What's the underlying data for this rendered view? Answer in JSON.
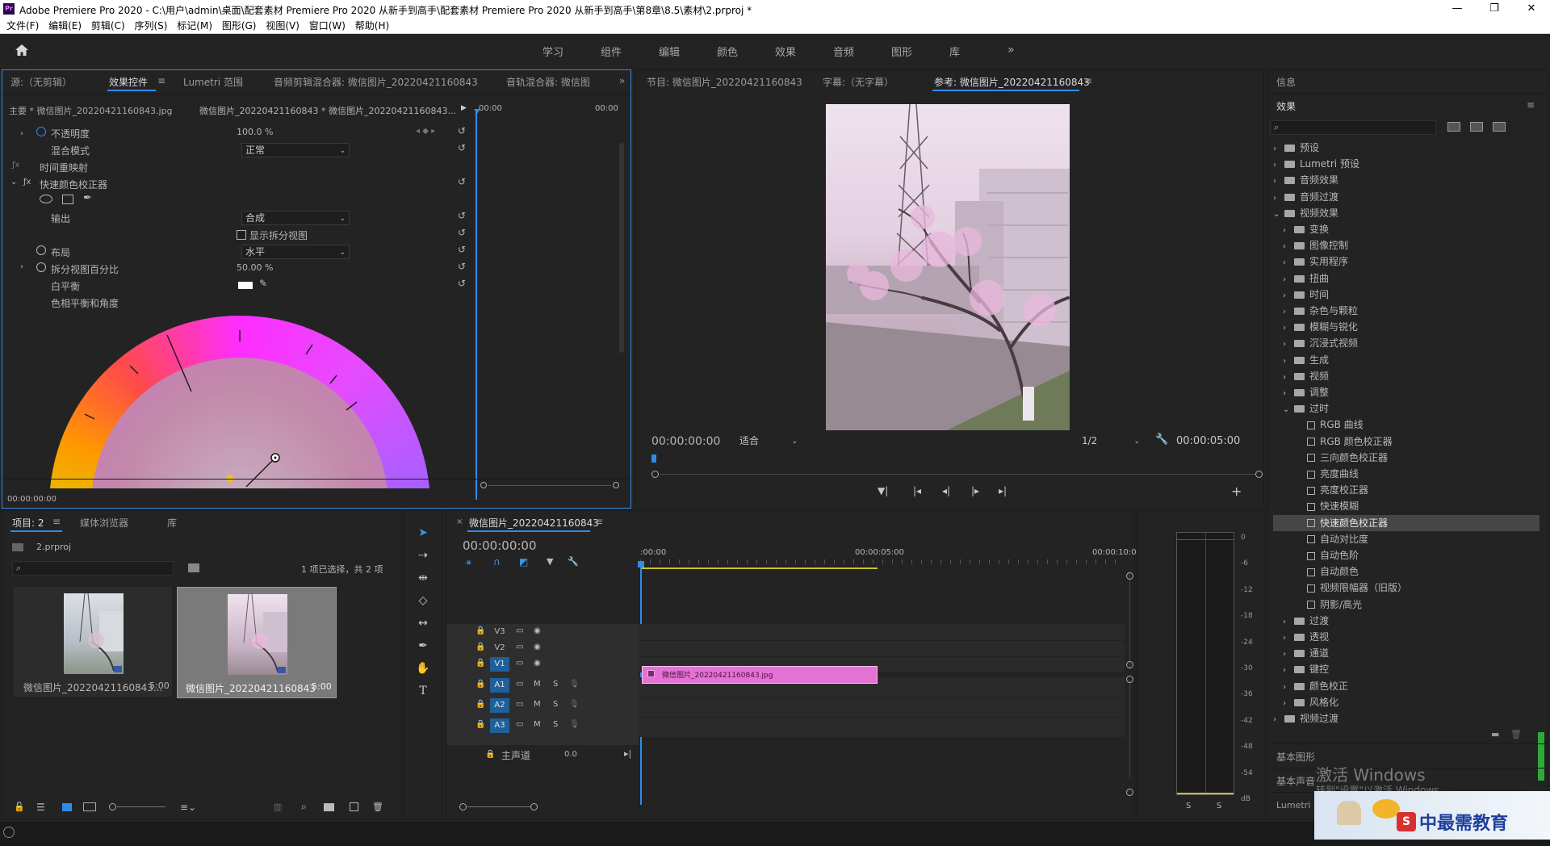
{
  "window": {
    "app_icon": "Pr",
    "title": "Adobe Premiere Pro 2020 - C:\\用户\\admin\\桌面\\配套素材 Premiere Pro 2020 从新手到高手\\配套素材 Premiere Pro 2020 从新手到高手\\第8章\\8.5\\素材\\2.prproj *"
  },
  "menu": [
    "文件(F)",
    "编辑(E)",
    "剪辑(C)",
    "序列(S)",
    "标记(M)",
    "图形(G)",
    "视图(V)",
    "窗口(W)",
    "帮助(H)"
  ],
  "workspaces": [
    "学习",
    "组件",
    "编辑",
    "颜色",
    "效果",
    "音频",
    "图形",
    "库"
  ],
  "left_tabs": {
    "source": "源:（无剪辑）",
    "effect_controls": "效果控件",
    "lumetri_scope": "Lumetri 范围",
    "audio_mixer": "音频剪辑混合器: 微信图片_20220421160843",
    "track_mixer": "音轨混合器: 微信图"
  },
  "ec": {
    "master": "主要 * 微信图片_20220421160843.jpg",
    "clip": "微信图片_20220421160843 * 微信图片_20220421160843...",
    "time_start": "00:00",
    "time_end": "00:00",
    "opacity": "不透明度",
    "opacity_val": "100.0 %",
    "blend": "混合模式",
    "blend_val": "正常",
    "remap": "时间重映射",
    "qcc": "快速颜色校正器",
    "output": "输出",
    "output_val": "合成",
    "split": "显示拆分视图",
    "layout": "布局",
    "layout_val": "水平",
    "split_pct": "拆分视图百分比",
    "split_pct_val": "50.00 %",
    "wb": "白平衡",
    "hue": "色相平衡和角度",
    "timecode": "00:00:00:00"
  },
  "monitor": {
    "tab_program": "节目: 微信图片_20220421160843",
    "tab_caption": "字幕:（无字幕）",
    "tab_ref": "参考: 微信图片_20220421160843",
    "tc_left": "00:00:00:00",
    "fit": "适合",
    "ratio": "1/2",
    "tc_right": "00:00:05:00"
  },
  "right": {
    "info": "信息",
    "effects": "效果",
    "basic_graphics": "基本图形",
    "basic_sound": "基本声音",
    "lumetri": "Lumetri",
    "tree": [
      {
        "label": "预设",
        "level": 0,
        "type": "folder",
        "open": false
      },
      {
        "label": "Lumetri 预设",
        "level": 0,
        "type": "folder",
        "open": false
      },
      {
        "label": "音频效果",
        "level": 0,
        "type": "folder",
        "open": false
      },
      {
        "label": "音频过渡",
        "level": 0,
        "type": "folder",
        "open": false
      },
      {
        "label": "视频效果",
        "level": 0,
        "type": "folder",
        "open": true
      },
      {
        "label": "变换",
        "level": 1,
        "type": "folder",
        "open": false
      },
      {
        "label": "图像控制",
        "level": 1,
        "type": "folder",
        "open": false
      },
      {
        "label": "实用程序",
        "level": 1,
        "type": "folder",
        "open": false
      },
      {
        "label": "扭曲",
        "level": 1,
        "type": "folder",
        "open": false
      },
      {
        "label": "时间",
        "level": 1,
        "type": "folder",
        "open": false
      },
      {
        "label": "杂色与颗粒",
        "level": 1,
        "type": "folder",
        "open": false
      },
      {
        "label": "模糊与锐化",
        "level": 1,
        "type": "folder",
        "open": false
      },
      {
        "label": "沉浸式视频",
        "level": 1,
        "type": "folder",
        "open": false
      },
      {
        "label": "生成",
        "level": 1,
        "type": "folder",
        "open": false
      },
      {
        "label": "视频",
        "level": 1,
        "type": "folder",
        "open": false
      },
      {
        "label": "调整",
        "level": 1,
        "type": "folder",
        "open": false
      },
      {
        "label": "过时",
        "level": 1,
        "type": "folder",
        "open": true
      },
      {
        "label": "RGB 曲线",
        "level": 2,
        "type": "fx"
      },
      {
        "label": "RGB 颜色校正器",
        "level": 2,
        "type": "fx"
      },
      {
        "label": "三向颜色校正器",
        "level": 2,
        "type": "fx"
      },
      {
        "label": "亮度曲线",
        "level": 2,
        "type": "fx"
      },
      {
        "label": "亮度校正器",
        "level": 2,
        "type": "fx"
      },
      {
        "label": "快速模糊",
        "level": 2,
        "type": "fx"
      },
      {
        "label": "快速颜色校正器",
        "level": 2,
        "type": "fx",
        "selected": true
      },
      {
        "label": "自动对比度",
        "level": 2,
        "type": "fx"
      },
      {
        "label": "自动色阶",
        "level": 2,
        "type": "fx"
      },
      {
        "label": "自动颜色",
        "level": 2,
        "type": "fx"
      },
      {
        "label": "视频限幅器（旧版）",
        "level": 2,
        "type": "fx"
      },
      {
        "label": "阴影/高光",
        "level": 2,
        "type": "fx"
      },
      {
        "label": "过渡",
        "level": 1,
        "type": "folder",
        "open": false
      },
      {
        "label": "透视",
        "level": 1,
        "type": "folder",
        "open": false
      },
      {
        "label": "通道",
        "level": 1,
        "type": "folder",
        "open": false
      },
      {
        "label": "键控",
        "level": 1,
        "type": "folder",
        "open": false
      },
      {
        "label": "颜色校正",
        "level": 1,
        "type": "folder",
        "open": false
      },
      {
        "label": "风格化",
        "level": 1,
        "type": "folder",
        "open": false
      },
      {
        "label": "视频过渡",
        "level": 0,
        "type": "folder",
        "open": false
      }
    ]
  },
  "project": {
    "tab": "项目: 2",
    "media": "媒体浏览器",
    "lib": "库",
    "file": "2.prproj",
    "selected": "1 项已选择，共 2 项",
    "items": [
      {
        "name": "微信图片_20220421160843...",
        "dur": "5:00"
      },
      {
        "name": "微信图片_20220421160843",
        "dur": "5:00"
      }
    ]
  },
  "timeline": {
    "tab": "微信图片_20220421160843",
    "tc": "00:00:00:00",
    "r0": ":00:00",
    "r1": "00:00:05:00",
    "r2": "00:00:10:00",
    "video_tracks": [
      "V3",
      "V2",
      "V1"
    ],
    "audio_tracks": [
      "A1",
      "A2",
      "A3"
    ],
    "m": "M",
    "s": "S",
    "master": "主声道",
    "master_val": "0.0",
    "clip": "微信图片_20220421160843.jpg"
  },
  "meter": {
    "ticks": [
      "0",
      "-6",
      "-12",
      "-18",
      "-24",
      "-30",
      "-36",
      "-42",
      "-48",
      "-54",
      "dB"
    ],
    "s": "S"
  },
  "overlay": {
    "activate": "激活 Windows",
    "hint": "转到\"设置\"以激活 Windows。",
    "logo": "中最需教育"
  }
}
